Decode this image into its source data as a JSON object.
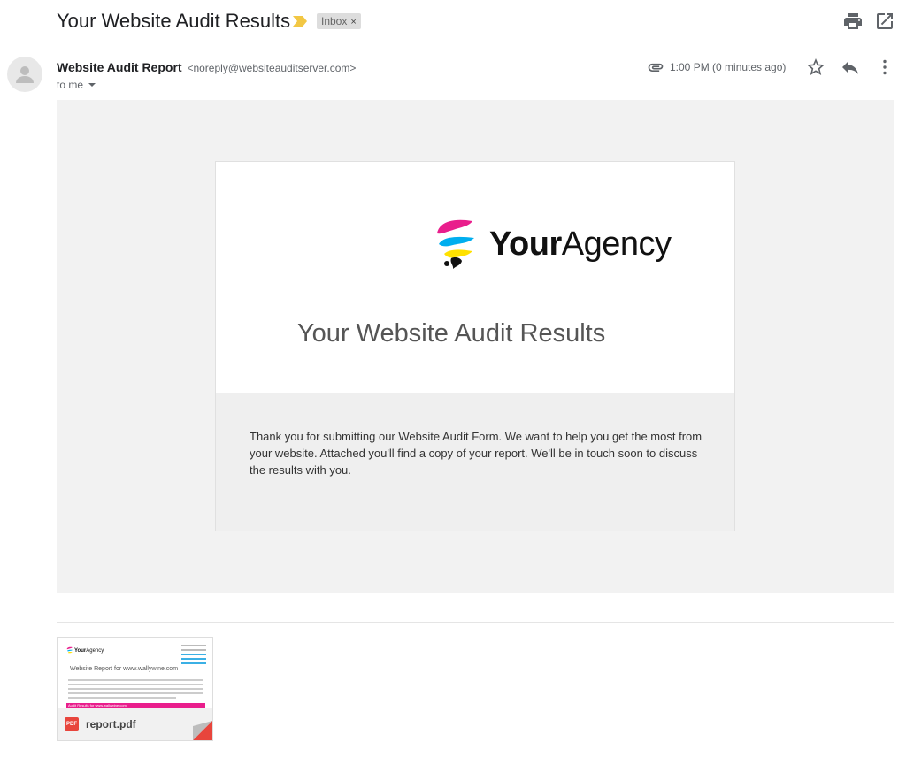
{
  "email": {
    "subject": "Your Website Audit Results",
    "label": "Inbox",
    "label_remove": "×",
    "sender_name": "Website Audit Report",
    "sender_email": "<noreply@websiteauditserver.com>",
    "recipient": "to me",
    "time": "1:00 PM (0 minutes ago)"
  },
  "content": {
    "logo_bold": "Your",
    "logo_light": "Agency",
    "headline": "Your Website Audit Results",
    "message": "Thank you for submitting our Website Audit Form. We want to help you get the most from your website. Attached you'll find a copy of your report. We'll be in touch soon to discuss the results with you."
  },
  "attachment": {
    "filename": "report.pdf",
    "type_badge": "PDF",
    "preview_logo_bold": "Your",
    "preview_logo_light": "Agency",
    "preview_title": "Website Report for www.wallywine.com",
    "preview_banner": "Audit Results for www.wallywine.com"
  },
  "colors": {
    "pdf_red": "#e8453c",
    "importance_yellow": "#f2c744",
    "logo_magenta": "#e91e8c",
    "logo_cyan": "#00aeef",
    "logo_yellow": "#ffe100"
  },
  "icons": [
    "importance-marker-icon",
    "print-icon",
    "open-in-new-window-icon",
    "avatar-person-icon",
    "paperclip-icon",
    "star-icon",
    "reply-icon",
    "more-vert-icon"
  ]
}
